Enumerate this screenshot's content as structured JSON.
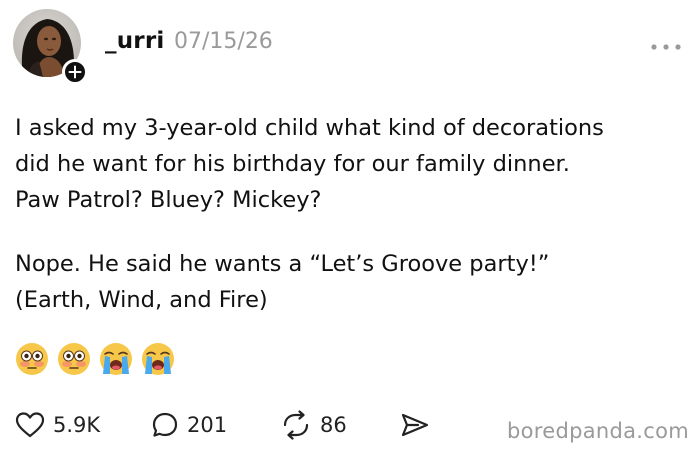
{
  "post": {
    "username": "_urri",
    "timestamp": "07/15/26",
    "paragraphs": {
      "p1_line1": "I asked my 3-year-old child what kind of decorations",
      "p1_line2": "did he want for his birthday for our family dinner.",
      "p1_line3": "Paw Patrol? Bluey? Mickey?",
      "p2_line1": "Nope. He said he wants a “Let’s Groove party!”",
      "p2_line2": "(Earth, Wind, and Fire)"
    },
    "emojis": [
      "flushed-face",
      "flushed-face",
      "loudly-crying-face",
      "loudly-crying-face"
    ]
  },
  "actions": {
    "likes": "5.9K",
    "replies": "201",
    "reposts": "86"
  },
  "icons": {
    "like": "heart-icon",
    "reply": "speech-bubble-icon",
    "repost": "repost-arrows-icon",
    "share": "send-icon",
    "more": "ellipsis-icon",
    "follow": "plus-icon"
  },
  "watermark": "boredpanda.com",
  "colors": {
    "text": "#111111",
    "muted": "#9a9a9a",
    "badge": "#111111"
  }
}
